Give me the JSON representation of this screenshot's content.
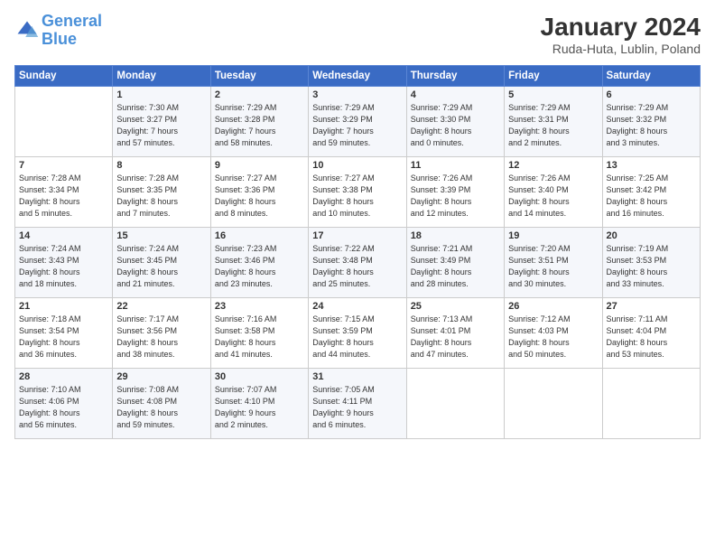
{
  "logo": {
    "line1": "General",
    "line2": "Blue"
  },
  "title": "January 2024",
  "location": "Ruda-Huta, Lublin, Poland",
  "days_of_week": [
    "Sunday",
    "Monday",
    "Tuesday",
    "Wednesday",
    "Thursday",
    "Friday",
    "Saturday"
  ],
  "weeks": [
    [
      {
        "day": "",
        "info": ""
      },
      {
        "day": "1",
        "info": "Sunrise: 7:30 AM\nSunset: 3:27 PM\nDaylight: 7 hours\nand 57 minutes."
      },
      {
        "day": "2",
        "info": "Sunrise: 7:29 AM\nSunset: 3:28 PM\nDaylight: 7 hours\nand 58 minutes."
      },
      {
        "day": "3",
        "info": "Sunrise: 7:29 AM\nSunset: 3:29 PM\nDaylight: 7 hours\nand 59 minutes."
      },
      {
        "day": "4",
        "info": "Sunrise: 7:29 AM\nSunset: 3:30 PM\nDaylight: 8 hours\nand 0 minutes."
      },
      {
        "day": "5",
        "info": "Sunrise: 7:29 AM\nSunset: 3:31 PM\nDaylight: 8 hours\nand 2 minutes."
      },
      {
        "day": "6",
        "info": "Sunrise: 7:29 AM\nSunset: 3:32 PM\nDaylight: 8 hours\nand 3 minutes."
      }
    ],
    [
      {
        "day": "7",
        "info": "Sunrise: 7:28 AM\nSunset: 3:34 PM\nDaylight: 8 hours\nand 5 minutes."
      },
      {
        "day": "8",
        "info": "Sunrise: 7:28 AM\nSunset: 3:35 PM\nDaylight: 8 hours\nand 7 minutes."
      },
      {
        "day": "9",
        "info": "Sunrise: 7:27 AM\nSunset: 3:36 PM\nDaylight: 8 hours\nand 8 minutes."
      },
      {
        "day": "10",
        "info": "Sunrise: 7:27 AM\nSunset: 3:38 PM\nDaylight: 8 hours\nand 10 minutes."
      },
      {
        "day": "11",
        "info": "Sunrise: 7:26 AM\nSunset: 3:39 PM\nDaylight: 8 hours\nand 12 minutes."
      },
      {
        "day": "12",
        "info": "Sunrise: 7:26 AM\nSunset: 3:40 PM\nDaylight: 8 hours\nand 14 minutes."
      },
      {
        "day": "13",
        "info": "Sunrise: 7:25 AM\nSunset: 3:42 PM\nDaylight: 8 hours\nand 16 minutes."
      }
    ],
    [
      {
        "day": "14",
        "info": "Sunrise: 7:24 AM\nSunset: 3:43 PM\nDaylight: 8 hours\nand 18 minutes."
      },
      {
        "day": "15",
        "info": "Sunrise: 7:24 AM\nSunset: 3:45 PM\nDaylight: 8 hours\nand 21 minutes."
      },
      {
        "day": "16",
        "info": "Sunrise: 7:23 AM\nSunset: 3:46 PM\nDaylight: 8 hours\nand 23 minutes."
      },
      {
        "day": "17",
        "info": "Sunrise: 7:22 AM\nSunset: 3:48 PM\nDaylight: 8 hours\nand 25 minutes."
      },
      {
        "day": "18",
        "info": "Sunrise: 7:21 AM\nSunset: 3:49 PM\nDaylight: 8 hours\nand 28 minutes."
      },
      {
        "day": "19",
        "info": "Sunrise: 7:20 AM\nSunset: 3:51 PM\nDaylight: 8 hours\nand 30 minutes."
      },
      {
        "day": "20",
        "info": "Sunrise: 7:19 AM\nSunset: 3:53 PM\nDaylight: 8 hours\nand 33 minutes."
      }
    ],
    [
      {
        "day": "21",
        "info": "Sunrise: 7:18 AM\nSunset: 3:54 PM\nDaylight: 8 hours\nand 36 minutes."
      },
      {
        "day": "22",
        "info": "Sunrise: 7:17 AM\nSunset: 3:56 PM\nDaylight: 8 hours\nand 38 minutes."
      },
      {
        "day": "23",
        "info": "Sunrise: 7:16 AM\nSunset: 3:58 PM\nDaylight: 8 hours\nand 41 minutes."
      },
      {
        "day": "24",
        "info": "Sunrise: 7:15 AM\nSunset: 3:59 PM\nDaylight: 8 hours\nand 44 minutes."
      },
      {
        "day": "25",
        "info": "Sunrise: 7:13 AM\nSunset: 4:01 PM\nDaylight: 8 hours\nand 47 minutes."
      },
      {
        "day": "26",
        "info": "Sunrise: 7:12 AM\nSunset: 4:03 PM\nDaylight: 8 hours\nand 50 minutes."
      },
      {
        "day": "27",
        "info": "Sunrise: 7:11 AM\nSunset: 4:04 PM\nDaylight: 8 hours\nand 53 minutes."
      }
    ],
    [
      {
        "day": "28",
        "info": "Sunrise: 7:10 AM\nSunset: 4:06 PM\nDaylight: 8 hours\nand 56 minutes."
      },
      {
        "day": "29",
        "info": "Sunrise: 7:08 AM\nSunset: 4:08 PM\nDaylight: 8 hours\nand 59 minutes."
      },
      {
        "day": "30",
        "info": "Sunrise: 7:07 AM\nSunset: 4:10 PM\nDaylight: 9 hours\nand 2 minutes."
      },
      {
        "day": "31",
        "info": "Sunrise: 7:05 AM\nSunset: 4:11 PM\nDaylight: 9 hours\nand 6 minutes."
      },
      {
        "day": "",
        "info": ""
      },
      {
        "day": "",
        "info": ""
      },
      {
        "day": "",
        "info": ""
      }
    ]
  ]
}
